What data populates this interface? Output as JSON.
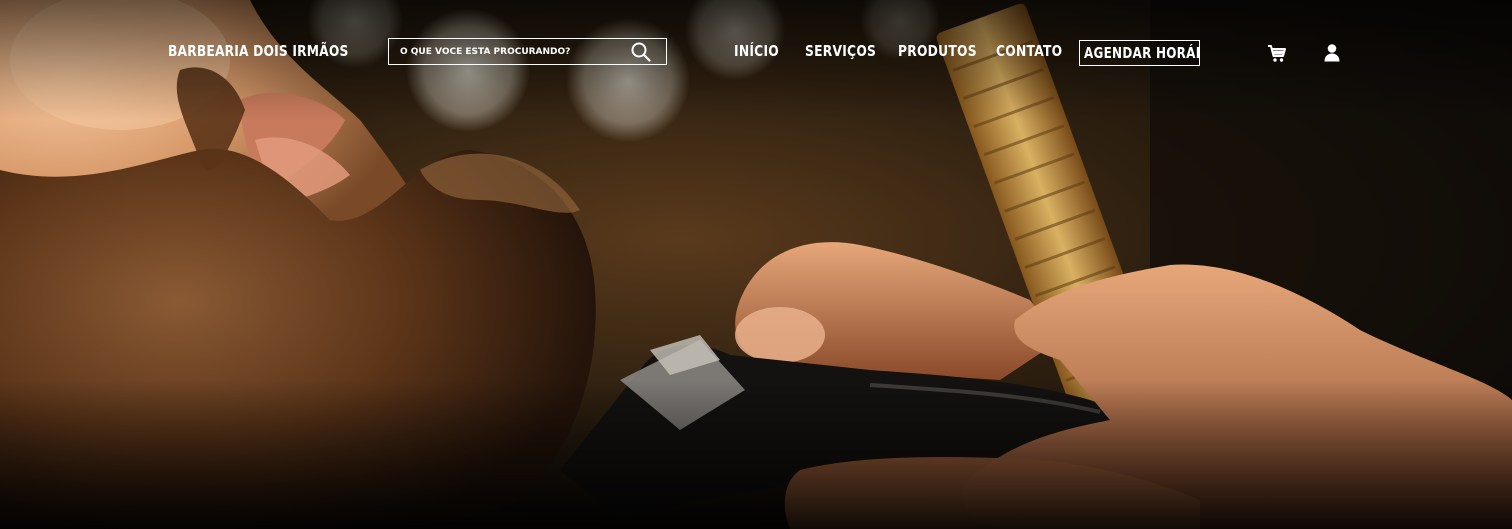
{
  "header": {
    "brand": "BARBEARIA DOIS IRMÃOS",
    "search": {
      "placeholder": "O QUE VOCÊ ESTA PROCURANDO?",
      "icon": "search-icon"
    },
    "nav": [
      {
        "label": "INÍCIO"
      },
      {
        "label": "SERVIÇOS"
      },
      {
        "label": "PRODUTOS"
      },
      {
        "label": "CONTATO"
      }
    ],
    "cta_label": "AGENDAR HORÁRIO",
    "icons": {
      "cart": "cart-icon",
      "account": "user-icon"
    }
  },
  "colors": {
    "text": "#ffffff",
    "hero_dark": "#0b0806",
    "skin": "#d79a6a",
    "beard": "#4a2a14",
    "comb_gold": "#c79a3c",
    "clipper": "#151515"
  }
}
